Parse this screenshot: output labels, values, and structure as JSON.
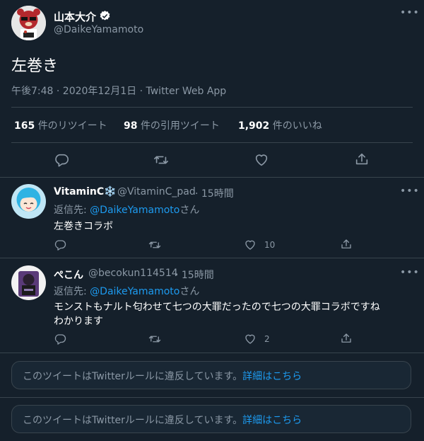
{
  "main_tweet": {
    "author_name": "山本大介",
    "handle": "@DaikeYamamoto",
    "text": "左巻き",
    "timestamp": "午後7:48 · 2020年12月1日 · Twitter Web App",
    "stats": [
      {
        "count": "165",
        "label": "件のリツイート"
      },
      {
        "count": "98",
        "label": "件の引用ツイート"
      },
      {
        "count": "1,902",
        "label": "件のいいね"
      }
    ]
  },
  "replies": [
    {
      "name": "VitaminC❄️",
      "handle": "@VitaminC_pad",
      "time": "· 15時間",
      "reply_prefix": "返信先:",
      "reply_to": "@DaikeYamamoto",
      "reply_suffix": "さん",
      "text": "左巻きコラボ",
      "likes": "10"
    },
    {
      "name": "ぺこん",
      "handle": "@becokun114514",
      "time": "· 15時間",
      "reply_prefix": "返信先:",
      "reply_to": "@DaikeYamamoto",
      "reply_suffix": "さん",
      "text_line1": "モンストもナルト匂わせて七つの大罪だったので七つの大罪コラボですね",
      "text_line2": "わかります",
      "likes": "2"
    }
  ],
  "violation_notices": [
    {
      "text": "このツイートはTwitterルールに違反しています。",
      "link": "詳細はこちら"
    },
    {
      "text": "このツイートはTwitterルールに違反しています。",
      "link": "詳細はこちら"
    }
  ],
  "colors": {
    "background": "#15202b",
    "accent": "#1d9bf0",
    "muted": "#8b98a5",
    "border": "#38444d"
  },
  "icons": [
    "verified-badge-icon",
    "more-icon",
    "reply-icon",
    "retweet-icon",
    "like-icon",
    "share-icon"
  ]
}
